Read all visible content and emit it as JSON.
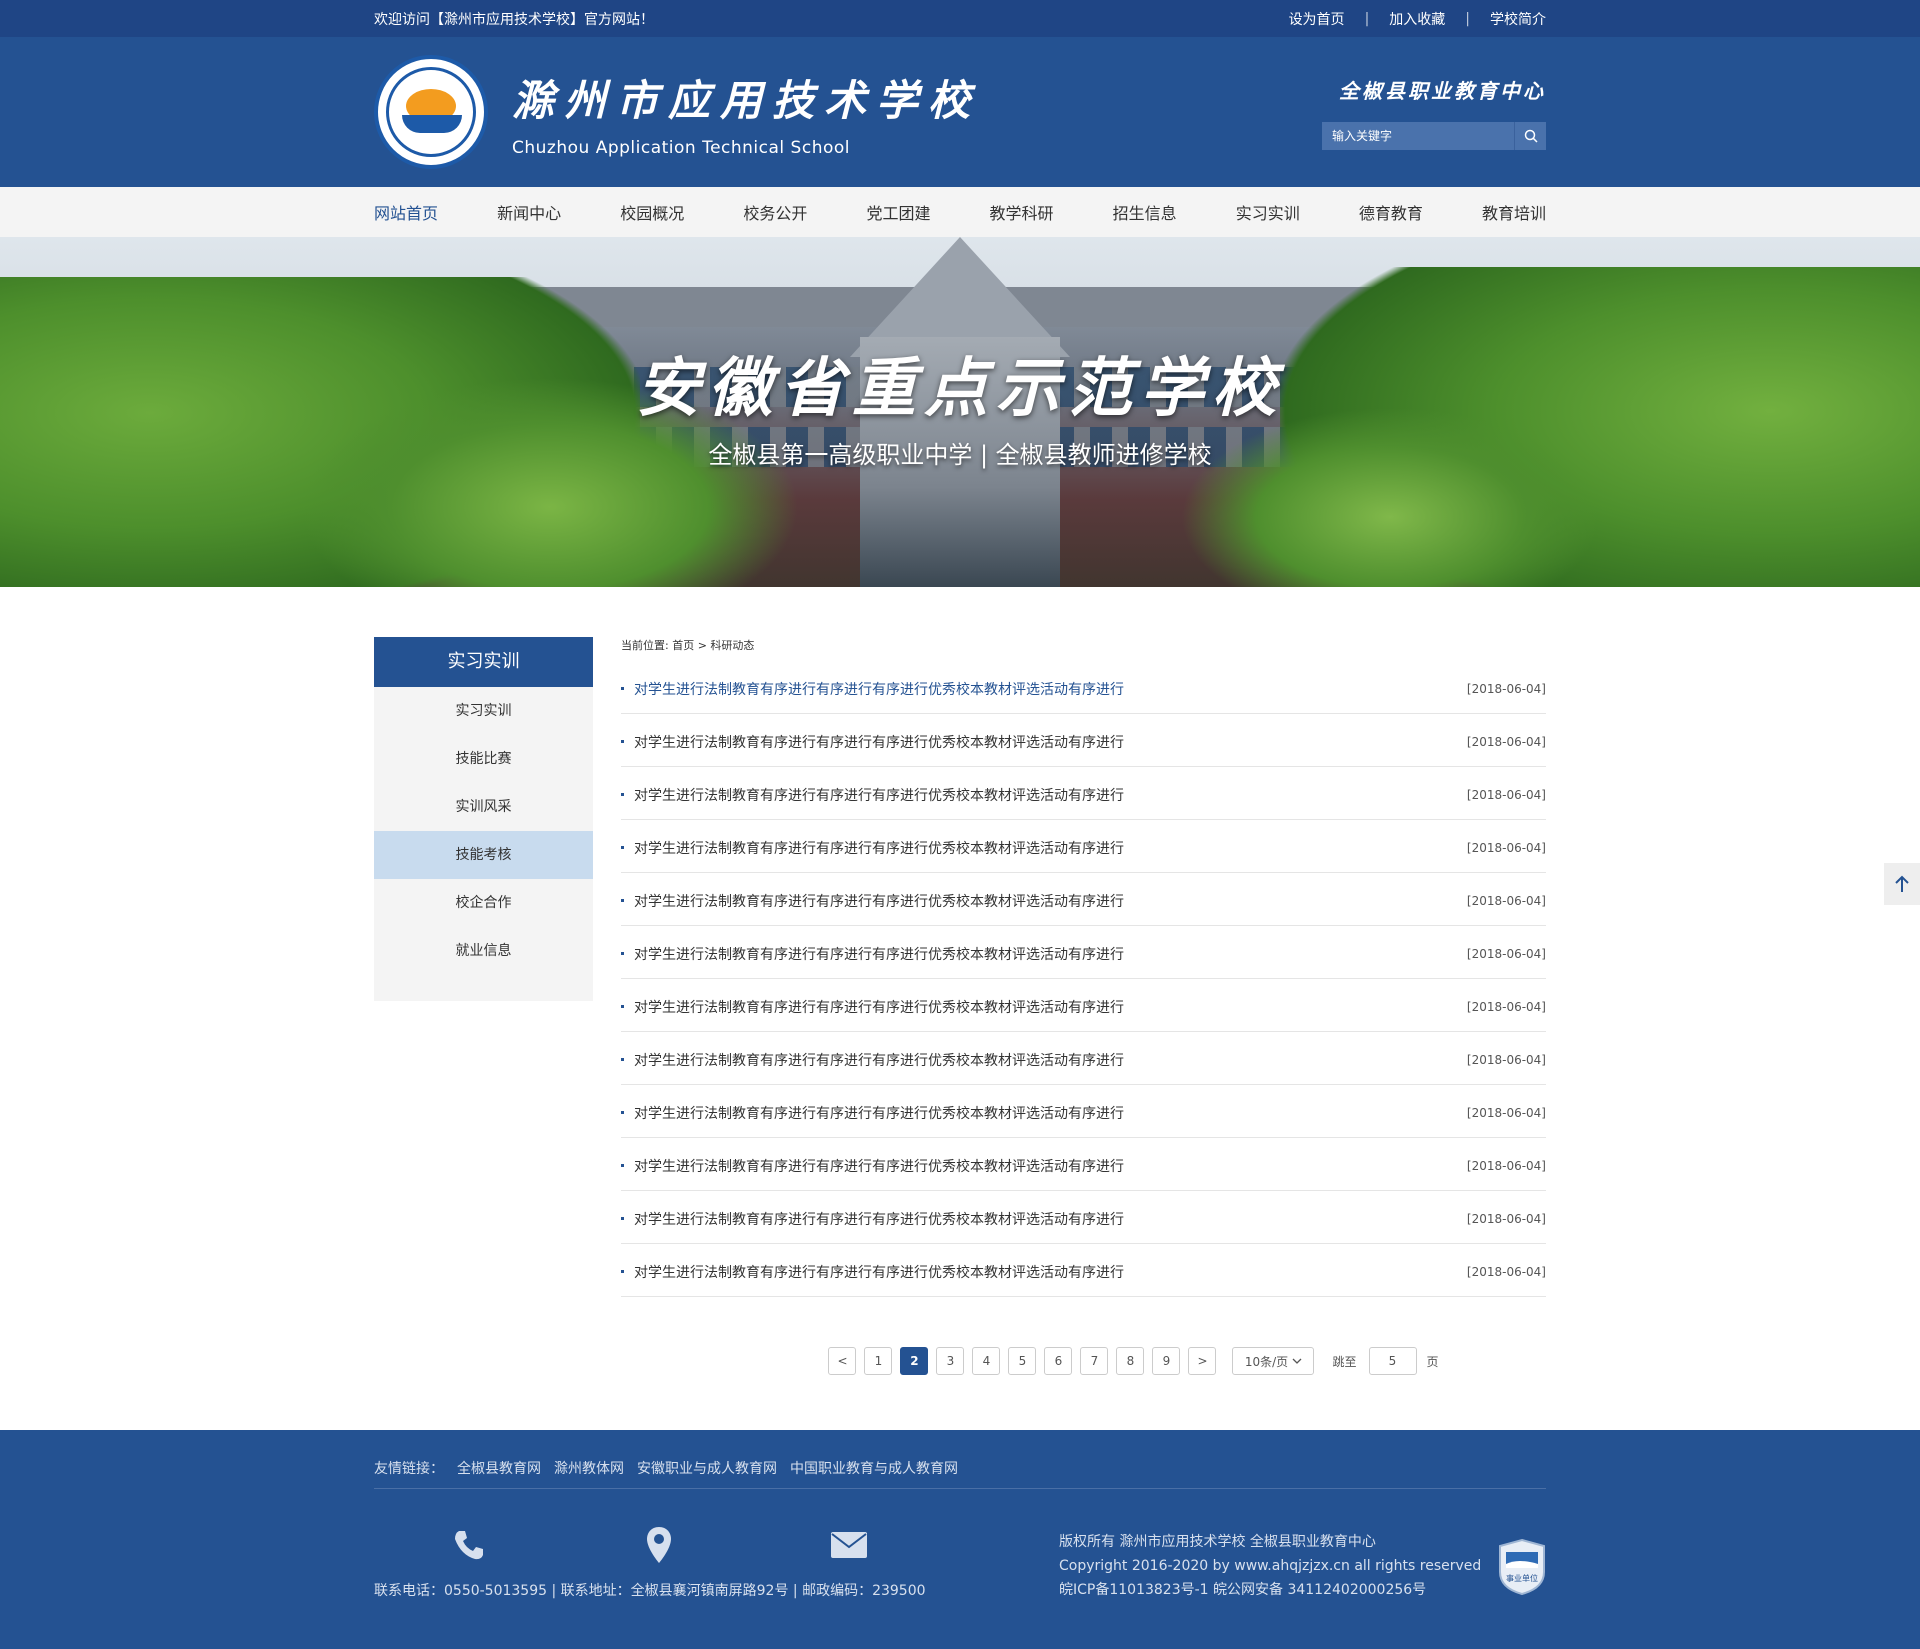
{
  "topbar": {
    "welcome": "欢迎访问【滁州市应用技术学校】官方网站！",
    "links": [
      "设为首页",
      "加入收藏",
      "学校简介"
    ],
    "separator": "|"
  },
  "header": {
    "name_cn": "滁州市应用技术学校",
    "name_en": "Chuzhou Application Technical School",
    "slogan": "全椒县职业教育中心",
    "search_placeholder": "输入关键字",
    "search_icon": "search-icon"
  },
  "nav": {
    "items": [
      "网站首页",
      "新闻中心",
      "校园概况",
      "校务公开",
      "党工团建",
      "教学科研",
      "招生信息",
      "实习实训",
      "德育教育",
      "教育培训"
    ],
    "active_index": 0
  },
  "banner": {
    "title": "安徽省重点示范学校",
    "subtitle": "全椒县第一高级职业中学 | 全椒县教师进修学校"
  },
  "sidebar": {
    "title": "实习实训",
    "items": [
      "实习实训",
      "技能比赛",
      "实训风采",
      "技能考核",
      "校企合作",
      "就业信息"
    ],
    "active_index": 3
  },
  "breadcrumb": "当前位置: 首页 > 科研动态",
  "news": [
    {
      "title": "对学生进行法制教育有序进行有序进行有序进行优秀校本教材评选活动有序进行",
      "date": "[2018-06-04]"
    },
    {
      "title": "对学生进行法制教育有序进行有序进行有序进行优秀校本教材评选活动有序进行",
      "date": "[2018-06-04]"
    },
    {
      "title": "对学生进行法制教育有序进行有序进行有序进行优秀校本教材评选活动有序进行",
      "date": "[2018-06-04]"
    },
    {
      "title": "对学生进行法制教育有序进行有序进行有序进行优秀校本教材评选活动有序进行",
      "date": "[2018-06-04]"
    },
    {
      "title": "对学生进行法制教育有序进行有序进行有序进行优秀校本教材评选活动有序进行",
      "date": "[2018-06-04]"
    },
    {
      "title": "对学生进行法制教育有序进行有序进行有序进行优秀校本教材评选活动有序进行",
      "date": "[2018-06-04]"
    },
    {
      "title": "对学生进行法制教育有序进行有序进行有序进行优秀校本教材评选活动有序进行",
      "date": "[2018-06-04]"
    },
    {
      "title": "对学生进行法制教育有序进行有序进行有序进行优秀校本教材评选活动有序进行",
      "date": "[2018-06-04]"
    },
    {
      "title": "对学生进行法制教育有序进行有序进行有序进行优秀校本教材评选活动有序进行",
      "date": "[2018-06-04]"
    },
    {
      "title": "对学生进行法制教育有序进行有序进行有序进行优秀校本教材评选活动有序进行",
      "date": "[2018-06-04]"
    },
    {
      "title": "对学生进行法制教育有序进行有序进行有序进行优秀校本教材评选活动有序进行",
      "date": "[2018-06-04]"
    },
    {
      "title": "对学生进行法制教育有序进行有序进行有序进行优秀校本教材评选活动有序进行",
      "date": "[2018-06-04]"
    }
  ],
  "pagination": {
    "prev": "<",
    "next": ">",
    "pages": [
      "1",
      "2",
      "3",
      "4",
      "5",
      "6",
      "7",
      "8",
      "9"
    ],
    "current": "2",
    "page_size": "10条/页",
    "jump_label": "跳至",
    "jump_value": "5",
    "page_unit": "页"
  },
  "footer": {
    "links_label": "友情链接：",
    "links": [
      "全椒县教育网",
      "滁州教体网",
      "安徽职业与成人教育网",
      "中国职业教育与成人教育网"
    ],
    "icons": [
      "phone-icon",
      "location-pin-icon",
      "mail-icon"
    ],
    "contact": "联系电话：0550-5013595 | 联系地址：全椒县襄河镇南屏路92号 | 邮政编码：239500",
    "copyright_lines": [
      "版权所有 滁州市应用技术学校 全椒县职业教育中心",
      "Copyright 2016-2020 by www.ahqjzjzx.cn all rights reserved",
      "皖ICP备11013823号-1    皖公网安备 34112402000256号"
    ],
    "badge_text": "事业单位"
  },
  "colors": {
    "primary": "#245292",
    "topbar": "#1f4585",
    "sidebar_active": "#c8dbee",
    "nav_bg": "#f4f4f4"
  }
}
